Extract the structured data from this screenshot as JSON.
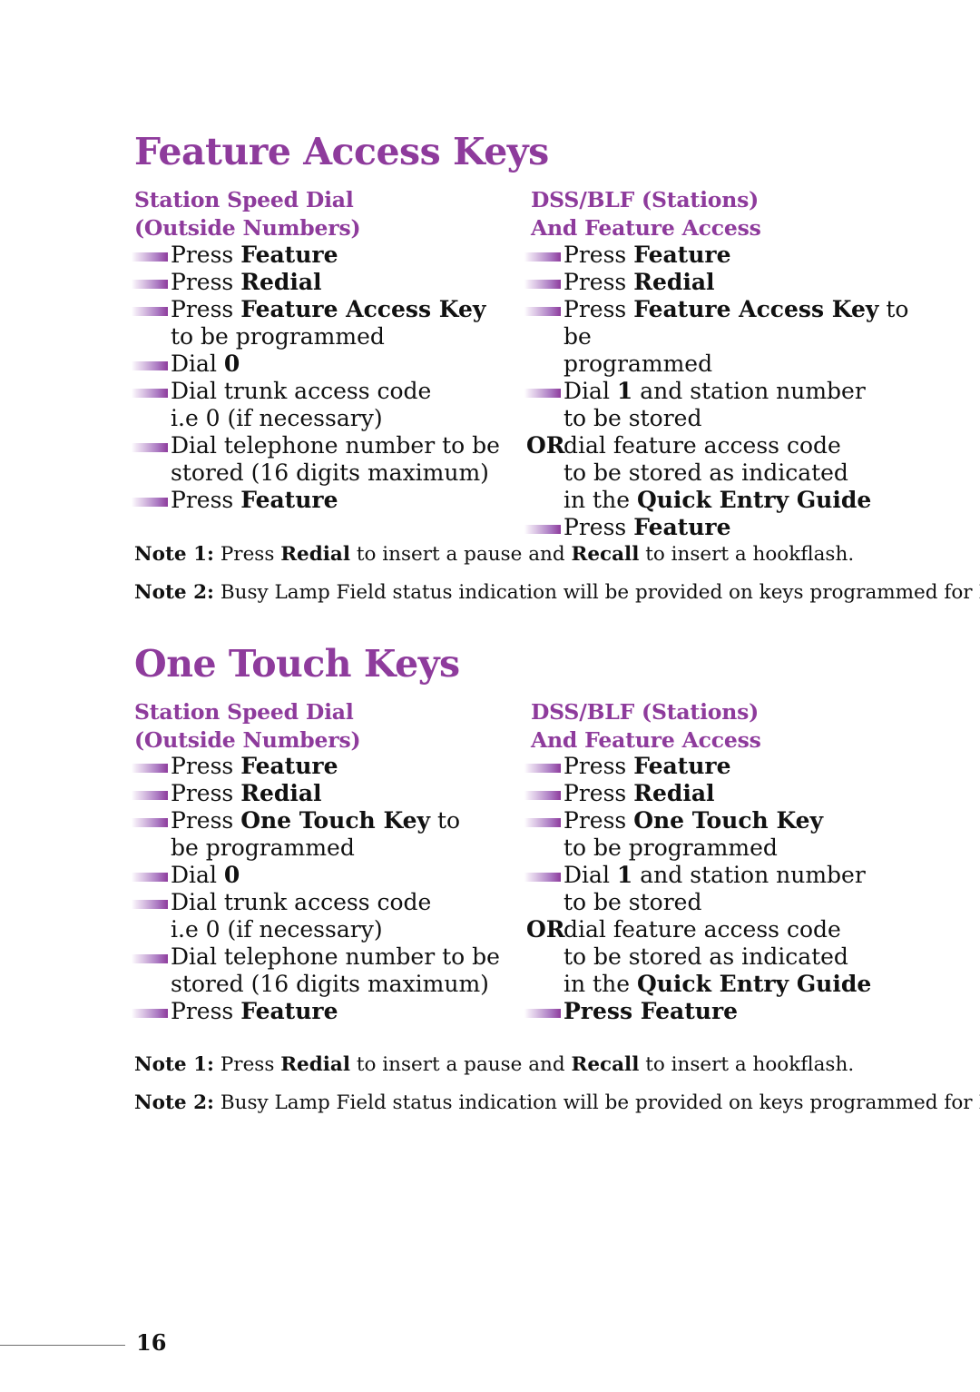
{
  "page": {
    "folio": "16"
  },
  "sections": [
    {
      "id": "feature-access-keys",
      "title": "Feature Access Keys",
      "columns": [
        {
          "id": "station-speed-dial",
          "heading_line1": "Station Speed Dial",
          "heading_line2": "(Outside Numbers)",
          "items": [
            {
              "bullet": true,
              "prefix": "Press ",
              "bold": "Feature",
              "suffix": "",
              "cont": ""
            },
            {
              "bullet": true,
              "prefix": "Press ",
              "bold": "Redial",
              "suffix": "",
              "cont": ""
            },
            {
              "bullet": true,
              "prefix": "Press ",
              "bold": "Feature Access Key",
              "suffix": "",
              "cont": "to be programmed"
            },
            {
              "bullet": true,
              "prefix": "Dial ",
              "bold": "0",
              "suffix": "",
              "cont": ""
            },
            {
              "bullet": true,
              "prefix": "Dial trunk access code",
              "bold": "",
              "suffix": "",
              "cont": "i.e 0 (if necessary)"
            },
            {
              "bullet": true,
              "prefix": "Dial telephone number to be",
              "bold": "",
              "suffix": "",
              "cont": "stored (16 digits maximum)"
            },
            {
              "bullet": true,
              "prefix": "Press ",
              "bold": "Feature",
              "suffix": "",
              "cont": ""
            }
          ]
        },
        {
          "id": "dss-blf-stations",
          "heading_line1": "DSS/BLF (Stations)",
          "heading_line2": "And Feature Access",
          "items": [
            {
              "bullet": true,
              "prefix": "Press ",
              "bold": "Feature",
              "suffix": "",
              "cont": ""
            },
            {
              "bullet": true,
              "prefix": "Press ",
              "bold": "Redial",
              "suffix": "",
              "cont": ""
            },
            {
              "bullet": true,
              "prefix": "Press ",
              "bold": "Feature Access Key",
              "suffix": " to be",
              "cont": "programmed"
            },
            {
              "bullet": true,
              "prefix": "Dial ",
              "bold": "1",
              "suffix": " and station number",
              "cont": "to be stored"
            },
            {
              "bullet": false,
              "or": "OR",
              "prefix": "dial feature access code",
              "bold": "",
              "suffix": "",
              "cont": "to be stored as indicated",
              "cont2_prefix": "in the ",
              "cont2_bold": "Quick Entry Guide"
            },
            {
              "bullet": true,
              "prefix": "Press ",
              "bold": "Feature",
              "suffix": "",
              "cont": ""
            }
          ]
        }
      ],
      "notes": [
        {
          "label": "Note 1:",
          "segments": [
            {
              "text": " Press ",
              "bold": false
            },
            {
              "text": "Redial",
              "bold": true
            },
            {
              "text": " to insert a pause and ",
              "bold": false
            },
            {
              "text": "Recall",
              "bold": true
            },
            {
              "text": " to insert a hookflash.",
              "bold": false
            }
          ]
        },
        {
          "label": "Note 2:",
          "segments": [
            {
              "text": " Busy Lamp Field status indication will be provided on keys programmed for DSS.",
              "bold": false
            }
          ]
        }
      ]
    },
    {
      "id": "one-touch-keys",
      "title": "One Touch Keys",
      "columns": [
        {
          "id": "station-speed-dial-ot",
          "heading_line1": "Station Speed Dial",
          "heading_line2": "(Outside Numbers)",
          "items": [
            {
              "bullet": true,
              "prefix": "Press ",
              "bold": "Feature",
              "suffix": "",
              "cont": ""
            },
            {
              "bullet": true,
              "prefix": "Press ",
              "bold": "Redial",
              "suffix": "",
              "cont": ""
            },
            {
              "bullet": true,
              "prefix": "Press ",
              "bold": "One Touch Key",
              "suffix": " to",
              "cont": "be programmed"
            },
            {
              "bullet": true,
              "prefix": "Dial ",
              "bold": "0",
              "suffix": "",
              "cont": ""
            },
            {
              "bullet": true,
              "prefix": "Dial trunk access code",
              "bold": "",
              "suffix": "",
              "cont": "i.e 0 (if necessary)"
            },
            {
              "bullet": true,
              "prefix": "Dial telephone number to be",
              "bold": "",
              "suffix": "",
              "cont": "stored (16 digits maximum)"
            },
            {
              "bullet": true,
              "prefix": "Press ",
              "bold": "Feature",
              "suffix": "",
              "cont": ""
            }
          ]
        },
        {
          "id": "dss-blf-stations-ot",
          "heading_line1": "DSS/BLF (Stations)",
          "heading_line2": "And Feature Access",
          "items": [
            {
              "bullet": true,
              "prefix": "Press ",
              "bold": "Feature",
              "suffix": "",
              "cont": ""
            },
            {
              "bullet": true,
              "prefix": "Press ",
              "bold": "Redial",
              "suffix": "",
              "cont": ""
            },
            {
              "bullet": true,
              "prefix": "Press ",
              "bold": "One Touch Key",
              "suffix": "",
              "cont": "to be programmed"
            },
            {
              "bullet": true,
              "prefix": "Dial ",
              "bold": "1",
              "suffix": " and station number",
              "cont": "to be stored"
            },
            {
              "bullet": false,
              "or": "OR",
              "prefix": "dial feature access code",
              "bold": "",
              "suffix": "",
              "cont": "to be stored as indicated",
              "cont2_prefix": "in the ",
              "cont2_bold": "Quick Entry Guide"
            },
            {
              "bullet": true,
              "all_bold": true,
              "prefix": "Press ",
              "bold": "Feature",
              "suffix": "",
              "cont": ""
            }
          ]
        }
      ],
      "notes": [
        {
          "label": "Note 1:",
          "segments": [
            {
              "text": " Press ",
              "bold": false
            },
            {
              "text": "Redial",
              "bold": true
            },
            {
              "text": " to insert a pause and ",
              "bold": false
            },
            {
              "text": "Recall",
              "bold": true
            },
            {
              "text": " to insert a hookflash.",
              "bold": false
            }
          ]
        },
        {
          "label": "Note 2:",
          "segments": [
            {
              "text": " Busy Lamp Field status indication will be provided on keys programmed for DSS.",
              "bold": false
            }
          ]
        }
      ]
    }
  ],
  "colors": {
    "purple": "#8E3B9C",
    "text": "#111111",
    "rule": "#6e6e6e"
  }
}
